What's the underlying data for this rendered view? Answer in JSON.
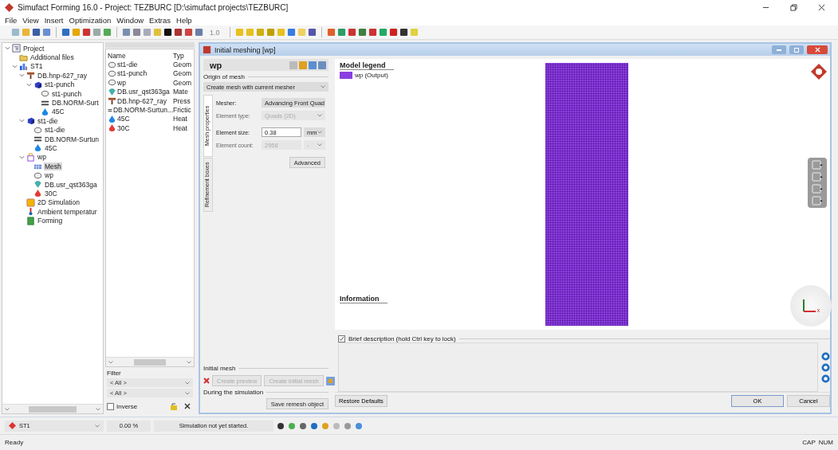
{
  "window": {
    "title": "Simufact Forming 16.0 - Project: TEZBURC [D:\\simufact projects\\TEZBURC]"
  },
  "menu": [
    "File",
    "View",
    "Insert",
    "Optimization",
    "Window",
    "Extras",
    "Help"
  ],
  "toolbar": {
    "zoom_value": "1.0"
  },
  "project_tree": [
    {
      "label": "Project",
      "kind": "project",
      "expanded": true,
      "selected": false,
      "children": [
        {
          "label": "Additional files",
          "kind": "folder",
          "selected": false
        },
        {
          "label": "ST1",
          "kind": "stage",
          "expanded": true,
          "selected": false,
          "children": [
            {
              "label": "DB.hnp-627_ray",
              "kind": "press",
              "expanded": true,
              "selected": false,
              "children": [
                {
                  "label": "st1-punch",
                  "kind": "tool",
                  "expanded": true,
                  "selected": false,
                  "children": [
                    {
                      "label": "st1-punch",
                      "kind": "geometry",
                      "selected": false
                    },
                    {
                      "label": "DB.NORM-Surt",
                      "kind": "friction",
                      "selected": false
                    },
                    {
                      "label": "45C",
                      "kind": "cooling",
                      "selected": false
                    }
                  ]
                }
              ]
            },
            {
              "label": "st1-die",
              "kind": "tool",
              "expanded": true,
              "selected": false,
              "children": [
                {
                  "label": "st1-die",
                  "kind": "geometry",
                  "selected": false
                },
                {
                  "label": "DB.NORM-Surtun",
                  "kind": "friction",
                  "selected": false
                },
                {
                  "label": "45C",
                  "kind": "cooling",
                  "selected": false
                }
              ]
            },
            {
              "label": "wp",
              "kind": "workpiece",
              "expanded": true,
              "selected": false,
              "children": [
                {
                  "label": "Mesh",
                  "kind": "mesh",
                  "selected": true
                },
                {
                  "label": "wp",
                  "kind": "geometry",
                  "selected": false
                },
                {
                  "label": "DB.usr_qst363ga",
                  "kind": "material",
                  "selected": false
                },
                {
                  "label": "30C",
                  "kind": "heating",
                  "selected": false
                }
              ]
            },
            {
              "label": "2D Simulation",
              "kind": "simulation",
              "selected": false
            },
            {
              "label": "Ambient temperatur",
              "kind": "temperature",
              "selected": false
            },
            {
              "label": "Forming",
              "kind": "process",
              "selected": false
            }
          ]
        }
      ]
    }
  ],
  "object_list": {
    "columns": [
      "Name",
      "Typ"
    ],
    "rows": [
      {
        "name": "st1-die",
        "type": "Geom",
        "kind": "geometry"
      },
      {
        "name": "st1-punch",
        "type": "Geom",
        "kind": "geometry"
      },
      {
        "name": "wp",
        "type": "Geom",
        "kind": "geometry"
      },
      {
        "name": "DB.usr_qst363ga",
        "type": "Mate",
        "kind": "material"
      },
      {
        "name": "DB.hnp-627_ray",
        "type": "Press",
        "kind": "press"
      },
      {
        "name": "DB.NORM-Surtun...",
        "type": "Frictic",
        "kind": "friction"
      },
      {
        "name": "45C",
        "type": "Heat",
        "kind": "cooling"
      },
      {
        "name": "30C",
        "type": "Heat",
        "kind": "heating"
      }
    ]
  },
  "filter": {
    "label": "Filter",
    "selects": [
      "< All >",
      "< All >"
    ],
    "inverse": {
      "label": "Inverse",
      "checked": false
    }
  },
  "dialog": {
    "title": "Initial meshing [wp]",
    "object_name": "wp",
    "origin_label": "Origin of mesh",
    "origin_value": "Create mesh with current mesher",
    "side_tabs": [
      {
        "label": "Mesh properties",
        "selected": true
      },
      {
        "label": "Refinement boxes",
        "selected": false
      }
    ],
    "fields": [
      {
        "label": "Mesher:",
        "value": "Advancing Front Quad",
        "kind": "select",
        "disabled": false
      },
      {
        "label": "Element type:",
        "value": "Quads (2D)",
        "kind": "select",
        "disabled": true
      },
      {
        "label": "Element size:",
        "value": "0.38",
        "unit": "mm",
        "kind": "input",
        "disabled": false
      },
      {
        "label": "Element count:",
        "value": "2958",
        "unit": "-",
        "kind": "input",
        "disabled": true
      }
    ],
    "advanced_button": "Advanced",
    "initial_mesh": {
      "label": "Initial mesh",
      "buttons": [
        {
          "label": "Create preview",
          "disabled": true
        },
        {
          "label": "Create initial mesh",
          "disabled": true
        }
      ]
    },
    "during_simulation": {
      "label": "During the simulation",
      "button": "Save remesh object"
    },
    "legend": {
      "title": "Model legend",
      "items": [
        {
          "label": "wp (Output)",
          "color": "#8a3fe0"
        }
      ]
    },
    "information_title": "Information",
    "axis_label": "x",
    "brief_description": {
      "label": "Brief description (hold Ctrl key to lock)",
      "checked": true
    },
    "buttons": {
      "restore": "Restore Defaults",
      "ok": "OK",
      "cancel": "Cancel"
    }
  },
  "bottom_bar": {
    "stage": "ST1",
    "progress": "0.00 %",
    "status": "Simulation not yet started."
  },
  "status_bar": {
    "text": "Ready",
    "indicators": [
      "CAP",
      "NUM"
    ]
  }
}
